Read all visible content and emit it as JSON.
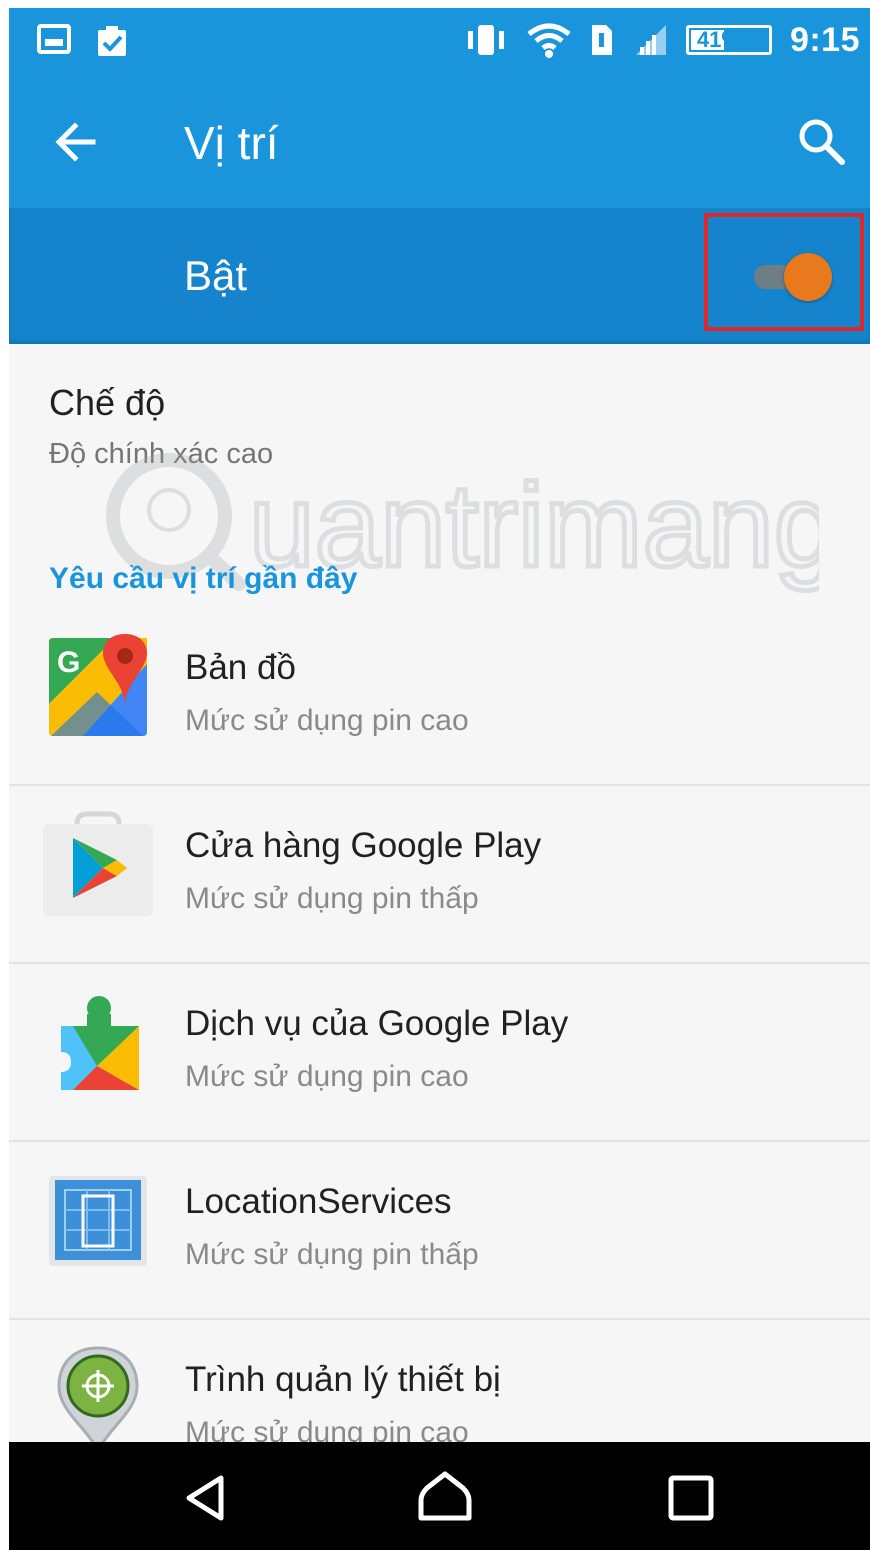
{
  "status_bar": {
    "time": "9:15",
    "battery_level": "41%",
    "battery_fraction": 0.41,
    "left_icons": [
      "gallery-icon",
      "clipboard-check-icon"
    ],
    "right_icons": [
      "vibrate-icon",
      "wifi-icon",
      "sim-icon",
      "signal-icon",
      "battery-charging-icon"
    ]
  },
  "toolbar": {
    "title": "Vị trí",
    "back_icon": "arrow-left-icon",
    "search_icon": "search-icon"
  },
  "location_switch": {
    "label": "Bật",
    "state": "on"
  },
  "mode": {
    "title": "Chế độ",
    "value": "Độ chính xác cao"
  },
  "recent_requests": {
    "header": "Yêu cầu vị trí gần đây",
    "apps": [
      {
        "name": "Bản đồ",
        "usage": "Mức sử dụng pin cao",
        "icon": "google-maps-icon"
      },
      {
        "name": "Cửa hàng Google Play",
        "usage": "Mức sử dụng pin thấp",
        "icon": "google-play-store-icon"
      },
      {
        "name": "Dịch vụ của Google Play",
        "usage": "Mức sử dụng pin cao",
        "icon": "google-play-services-icon"
      },
      {
        "name": "LocationServices",
        "usage": "Mức sử dụng pin thấp",
        "icon": "location-services-icon"
      },
      {
        "name": "Trình quản lý thiết bị",
        "usage": "Mức sử dụng pin cao",
        "icon": "device-manager-icon"
      }
    ]
  },
  "watermark": "uantrimang",
  "colors": {
    "primary": "#1a95dc",
    "primary_dark": "#1584cc",
    "switch_thumb": "#e8791c",
    "highlight_border": "#e02828",
    "accent_text": "#1a95dc"
  }
}
